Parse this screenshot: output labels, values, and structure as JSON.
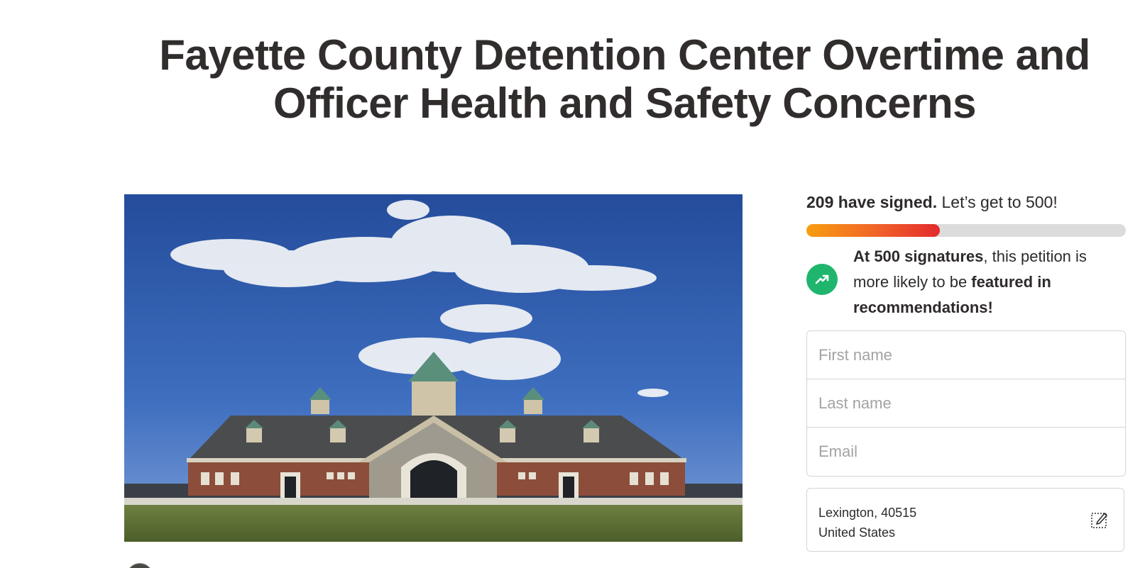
{
  "petition": {
    "title": "Fayette County Detention Center Overtime and Officer Health and Safety Concerns"
  },
  "hero_image": {
    "description_icon": "building-photo"
  },
  "progress": {
    "signed_bold": "209 have signed.",
    "goal_text": " Let’s get to 500!",
    "signed_count": 209,
    "goal_count": 500,
    "fraction": 0.418,
    "colors": {
      "start": "#f89e0f",
      "end": "#e32a2c",
      "track": "#dcdcdc"
    }
  },
  "promo": {
    "icon": "trending-up-icon",
    "icon_color": "#1fb56d",
    "part1_bold": "At 500 signatures",
    "part2": ", this petition is more likely to be ",
    "part3_bold": "featured in recommendations!"
  },
  "form": {
    "first_name_placeholder": "First name",
    "last_name_placeholder": "Last name",
    "email_placeholder": "Email"
  },
  "location": {
    "line1": "Lexington, 40515",
    "line2": "United States",
    "edit_icon": "edit-icon"
  }
}
